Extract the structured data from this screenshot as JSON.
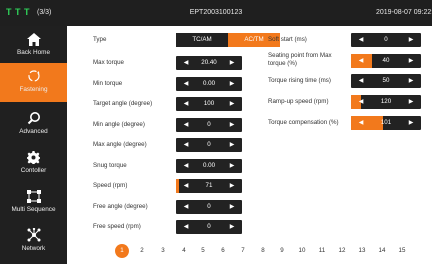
{
  "header": {
    "connection_count": "(3/3)",
    "device_id": "EPT2003100123",
    "datetime": "2019-08-07 09:22:",
    "signal_icon": "signal-bars-icon"
  },
  "sidebar": {
    "items": [
      {
        "label": "Back Home",
        "icon": "home-icon",
        "active": false
      },
      {
        "label": "Fastening",
        "icon": "fastening-icon",
        "active": true
      },
      {
        "label": "Advanced",
        "icon": "advanced-search-icon",
        "active": false
      },
      {
        "label": "Contoller",
        "icon": "gear-icon",
        "active": false
      },
      {
        "label": "Multi Sequence",
        "icon": "sequence-icon",
        "active": false
      },
      {
        "label": "Network",
        "icon": "network-icon",
        "active": false
      }
    ]
  },
  "colors": {
    "accent": "#f2791c",
    "dark": "#222222",
    "sidebar": "#202020",
    "topbar": "#1f1f1f"
  },
  "left_params": {
    "type": {
      "label": "Type",
      "options": [
        "TC/AM",
        "AC/TM"
      ],
      "selected": "AC/TM"
    },
    "rows": [
      {
        "label": "Max torque",
        "value": "20.40",
        "level": 0.0
      },
      {
        "label": "Min torque",
        "value": "0.00",
        "level": 0.0
      },
      {
        "label": "Target angle (degree)",
        "value": "100",
        "level": 0.0
      },
      {
        "label": "Min angle (degree)",
        "value": "0",
        "level": 0.0
      },
      {
        "label": "Max angle (degree)",
        "value": "0",
        "level": 0.0
      },
      {
        "label": "Snug torque",
        "value": "0.00",
        "level": 0.0
      },
      {
        "label": "Speed (rpm)",
        "value": "71",
        "level": 0.03
      },
      {
        "label": "Free angle (degree)",
        "value": "0",
        "level": 0.0
      },
      {
        "label": "Free speed (rpm)",
        "value": "0",
        "level": 0.0
      }
    ]
  },
  "right_params": {
    "rows": [
      {
        "label": "Soft start (ms)",
        "value": "0",
        "level": 0.0
      },
      {
        "label": "Seating point from Max torque (%)",
        "value": "40",
        "level": 0.3
      },
      {
        "label": "Torque rising time (ms)",
        "value": "50",
        "level": 0.0
      },
      {
        "label": "Ramp-up speed (rpm)",
        "value": "120",
        "level": 0.14
      },
      {
        "label": "Torque compensation (%)",
        "value": "101",
        "level": 0.45
      }
    ]
  },
  "pager": {
    "pages": [
      "1",
      "2",
      "3",
      "4",
      "5",
      "6",
      "7",
      "8",
      "9",
      "10",
      "11",
      "12",
      "13",
      "14",
      "15"
    ],
    "current": "1"
  }
}
